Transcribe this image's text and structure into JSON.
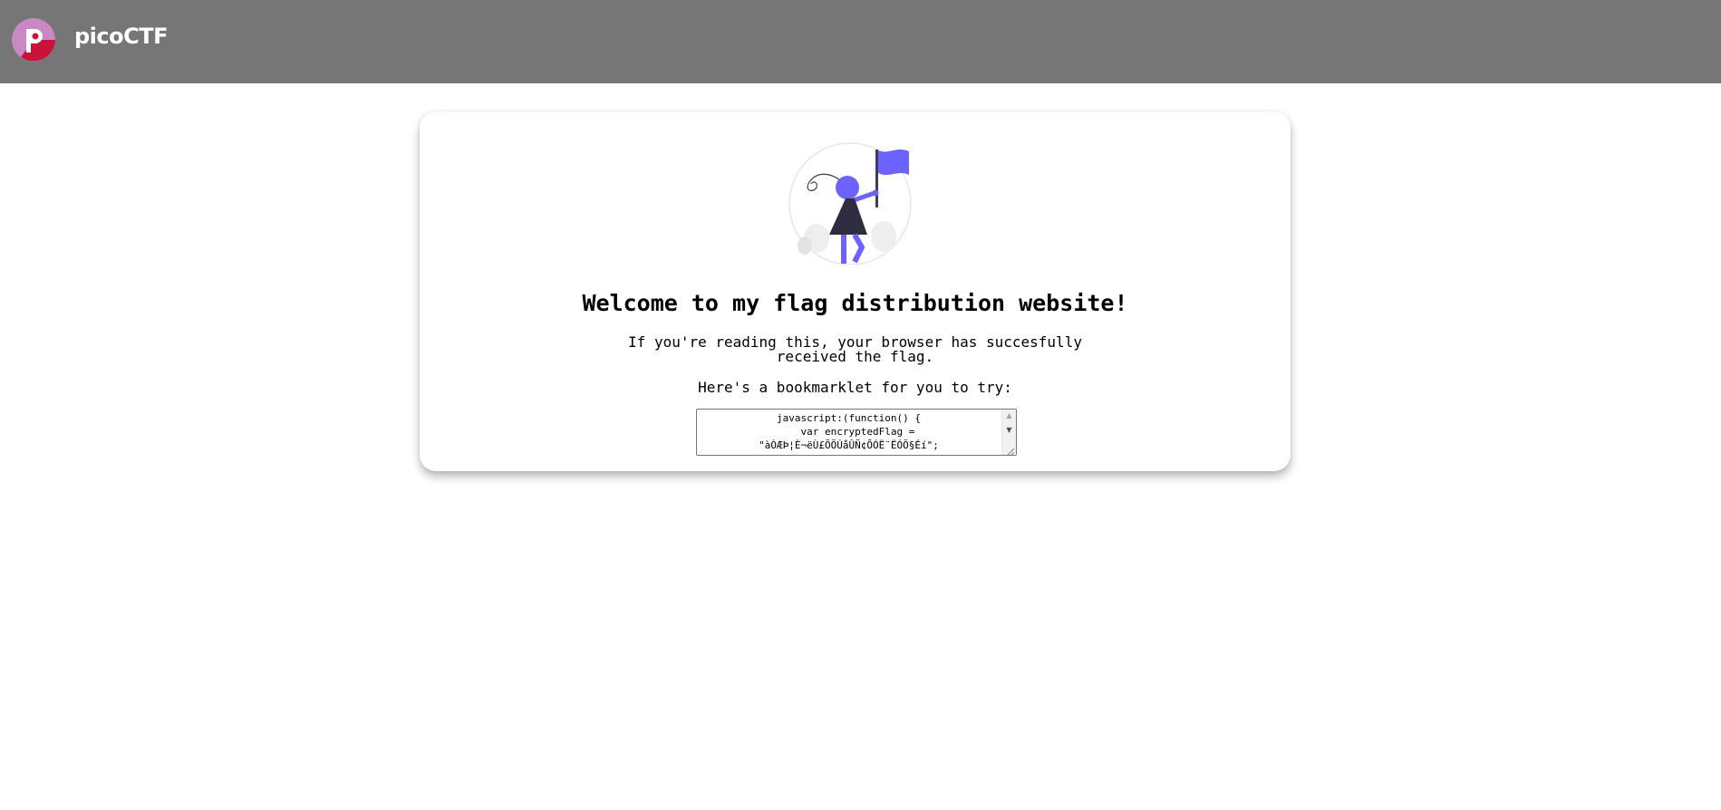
{
  "header": {
    "brand": "picoCTF",
    "logo_icon": "picoctf-logo",
    "background": "#767676"
  },
  "card": {
    "title": "Welcome to my flag distribution website!",
    "intro": "If you're reading this, your browser has succesfully received the flag.",
    "bookmarklet_prompt": "Here's a bookmarklet for you to try:",
    "bookmarklet_code": "javascript:(function() {\n    var encryptedFlag = \n\"àÒÆÞ¦È¬ëÙ£ÖÖÚåÛÑ¢ÕÓË¨ËÓÖ§Éí\";",
    "illustration_icon": "woman-with-flag-illustration",
    "accent_color": "#6c63ff"
  }
}
